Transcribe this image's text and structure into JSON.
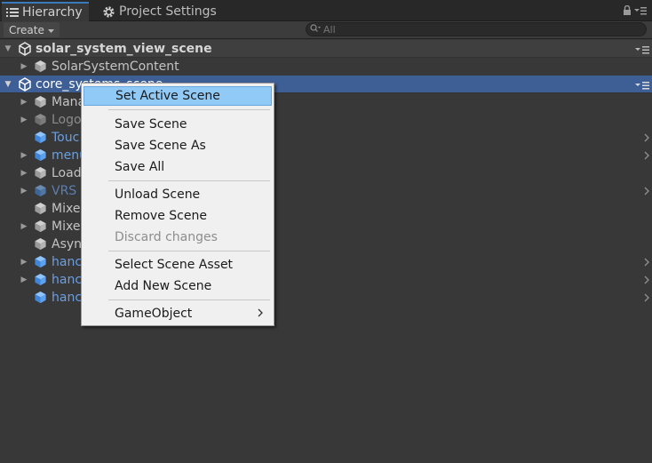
{
  "tabs": [
    {
      "label": "Hierarchy",
      "icon": "list-icon",
      "active": true
    },
    {
      "label": "Project Settings",
      "icon": "gear-icon",
      "active": false
    }
  ],
  "toolbar": {
    "create_label": "Create",
    "search_placeholder": "All"
  },
  "rows": [
    {
      "label": "solar_system_view_scene",
      "type": "scene",
      "expanded": true
    },
    {
      "label": "SolarSystemContent",
      "type": "gameobject",
      "indent": 1,
      "has_children": true
    },
    {
      "label": "core_systems_scene",
      "type": "scene",
      "expanded": true,
      "selected": true
    },
    {
      "label": "Mana",
      "type": "gameobject",
      "indent": 1,
      "has_children": true
    },
    {
      "label": "Logo",
      "type": "gameobject",
      "indent": 1,
      "has_children": true,
      "dim": true
    },
    {
      "label": "Touc",
      "type": "prefab",
      "indent": 1,
      "has_children": false
    },
    {
      "label": "menu",
      "type": "prefab",
      "indent": 1,
      "has_children": true
    },
    {
      "label": "Load",
      "type": "gameobject",
      "indent": 1,
      "has_children": true
    },
    {
      "label": "VRS",
      "type": "prefab",
      "indent": 1,
      "has_children": true,
      "dim": true
    },
    {
      "label": "Mixe",
      "type": "gameobject",
      "indent": 1,
      "has_children": false
    },
    {
      "label": "Mixe",
      "type": "gameobject",
      "indent": 1,
      "has_children": true
    },
    {
      "label": "Asyn",
      "type": "gameobject",
      "indent": 1,
      "has_children": false
    },
    {
      "label": "hanc",
      "type": "prefab",
      "indent": 1,
      "has_children": true
    },
    {
      "label": "hanc",
      "type": "prefab",
      "indent": 1,
      "has_children": true
    },
    {
      "label": "hanc",
      "type": "prefab",
      "indent": 1,
      "has_children": false
    }
  ],
  "context_menu": {
    "items": [
      {
        "label": "Set Active Scene",
        "highlighted": true
      },
      {
        "separator": true
      },
      {
        "label": "Save Scene"
      },
      {
        "label": "Save Scene As"
      },
      {
        "label": "Save All"
      },
      {
        "separator": true
      },
      {
        "label": "Unload Scene"
      },
      {
        "label": "Remove Scene"
      },
      {
        "label": "Discard changes",
        "disabled": true
      },
      {
        "separator": true
      },
      {
        "label": "Select Scene Asset"
      },
      {
        "label": "Add New Scene"
      },
      {
        "separator": true
      },
      {
        "label": "GameObject",
        "submenu": true
      }
    ]
  },
  "colors": {
    "background": "#383838",
    "selection": "#3e5f96",
    "prefab_text": "#6b9fe0",
    "menu_highlight": "#91c9f7"
  }
}
